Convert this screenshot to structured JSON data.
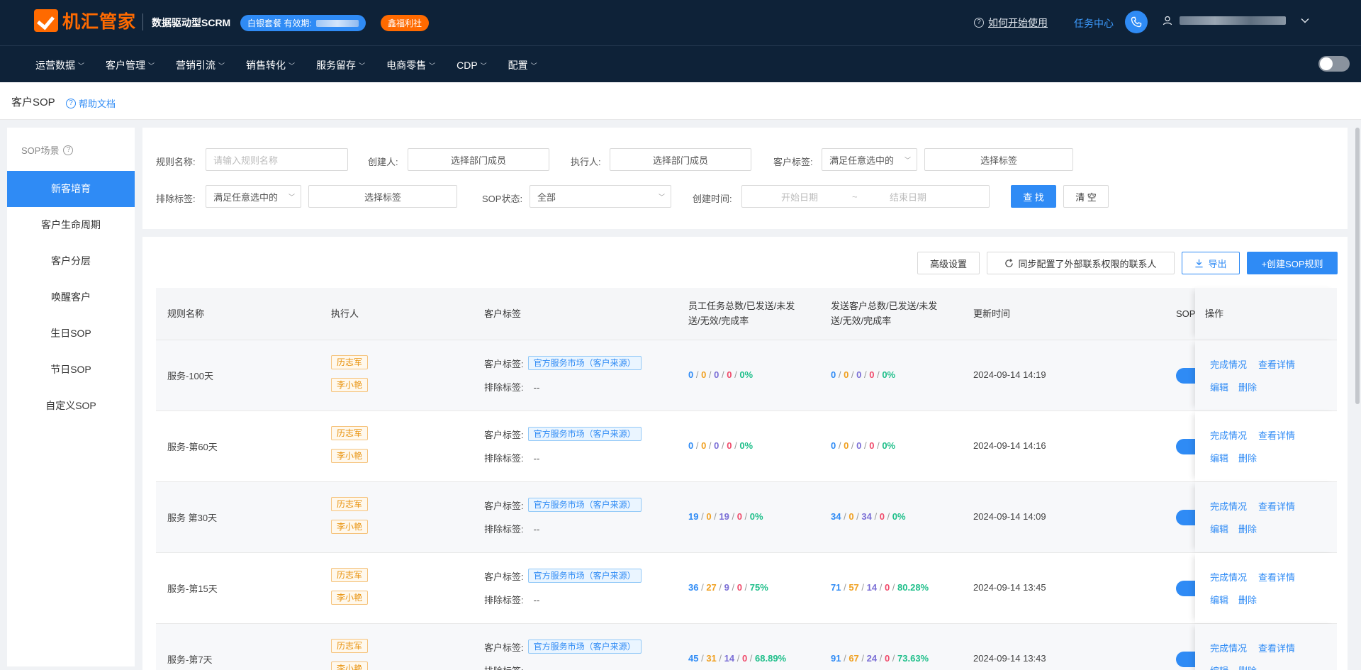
{
  "header": {
    "logo_text": "机汇管家",
    "subtitle": "数据驱动型SCRM",
    "plan_label": "白银套餐 有效期:",
    "welfare_label": "鑫福利社",
    "help_start": "如何开始使用",
    "task_center": "任务中心"
  },
  "nav": {
    "items": [
      {
        "label": "运营数据"
      },
      {
        "label": "客户管理"
      },
      {
        "label": "营销引流"
      },
      {
        "label": "销售转化"
      },
      {
        "label": "服务留存"
      },
      {
        "label": "电商零售"
      },
      {
        "label": "CDP"
      },
      {
        "label": "配置"
      }
    ]
  },
  "page": {
    "title": "客户SOP",
    "help_doc": "帮助文档"
  },
  "sidebar": {
    "title": "SOP场景",
    "items": [
      {
        "label": "新客培育",
        "active": true
      },
      {
        "label": "客户生命周期"
      },
      {
        "label": "客户分层"
      },
      {
        "label": "唤醒客户"
      },
      {
        "label": "生日SOP"
      },
      {
        "label": "节日SOP"
      },
      {
        "label": "自定义SOP"
      }
    ]
  },
  "filters": {
    "rule_name_label": "规则名称:",
    "rule_name_placeholder": "请输入规则名称",
    "creator_label": "创建人:",
    "creator_value": "选择部门成员",
    "executor_label": "执行人:",
    "executor_value": "选择部门成员",
    "customer_tag_label": "客户标签:",
    "customer_tag_mode": "满足任意选中的",
    "customer_tag_value": "选择标签",
    "exclude_tag_label": "排除标签:",
    "exclude_tag_mode": "满足任意选中的",
    "exclude_tag_value": "选择标签",
    "status_label": "SOP状态:",
    "status_value": "全部",
    "created_time_label": "创建时间:",
    "start_date_placeholder": "开始日期",
    "date_sep": "~",
    "end_date_placeholder": "结束日期",
    "search_button": "查 找",
    "clear_button": "清 空"
  },
  "toolbar": {
    "advanced": "高级设置",
    "sync": "同步配置了外部联系权限的联系人",
    "export": "导出",
    "create": "+创建SOP规则"
  },
  "table": {
    "headers": {
      "name": "规则名称",
      "executor": "执行人",
      "tags": "客户标签",
      "staff_stats_1": "员工任务总数/已发送/未发",
      "staff_stats_2": "送/无效/完成率",
      "customer_stats_1": "发送客户总数/已发送/未发",
      "customer_stats_2": "送/无效/完成率",
      "updated": "更新时间",
      "sop": "SOP",
      "ops": "操作"
    },
    "tag_label": "客户标签:",
    "exclude_label": "排除标签:",
    "exclude_value": "--",
    "op_progress": "完成情况",
    "op_detail": "查看详情",
    "op_edit": "编辑",
    "op_delete": "删除",
    "rows": [
      {
        "name": "服务-100天",
        "executors": [
          "历志军",
          "李小艳"
        ],
        "tag": "官方服务市场（客户来源）",
        "staff": [
          "0",
          "0",
          "0",
          "0",
          "0%"
        ],
        "customer": [
          "0",
          "0",
          "0",
          "0",
          "0%"
        ],
        "updated": "2024-09-14 14:19"
      },
      {
        "name": "服务-第60天",
        "executors": [
          "历志军",
          "李小艳"
        ],
        "tag": "官方服务市场（客户来源）",
        "staff": [
          "0",
          "0",
          "0",
          "0",
          "0%"
        ],
        "customer": [
          "0",
          "0",
          "0",
          "0",
          "0%"
        ],
        "updated": "2024-09-14 14:16"
      },
      {
        "name": "服务 第30天",
        "executors": [
          "历志军",
          "李小艳"
        ],
        "tag": "官方服务市场（客户来源）",
        "staff": [
          "19",
          "0",
          "19",
          "0",
          "0%"
        ],
        "customer": [
          "34",
          "0",
          "34",
          "0",
          "0%"
        ],
        "updated": "2024-09-14 14:09"
      },
      {
        "name": "服务-第15天",
        "executors": [
          "历志军",
          "李小艳"
        ],
        "tag": "官方服务市场（客户来源）",
        "staff": [
          "36",
          "27",
          "9",
          "0",
          "75%"
        ],
        "customer": [
          "71",
          "57",
          "14",
          "0",
          "80.28%"
        ],
        "updated": "2024-09-14 13:45"
      },
      {
        "name": "服务-第7天",
        "executors": [
          "历志军",
          "李小艳"
        ],
        "tag": "官方服务市场（客户来源）",
        "staff": [
          "45",
          "31",
          "14",
          "0",
          "68.89%"
        ],
        "customer": [
          "91",
          "67",
          "24",
          "0",
          "73.63%"
        ],
        "updated": "2024-09-14 13:43"
      }
    ]
  },
  "colors": {
    "primary": "#2f8bf5",
    "header_bg": "#0e2238",
    "brand_orange": "#ff6a00"
  }
}
